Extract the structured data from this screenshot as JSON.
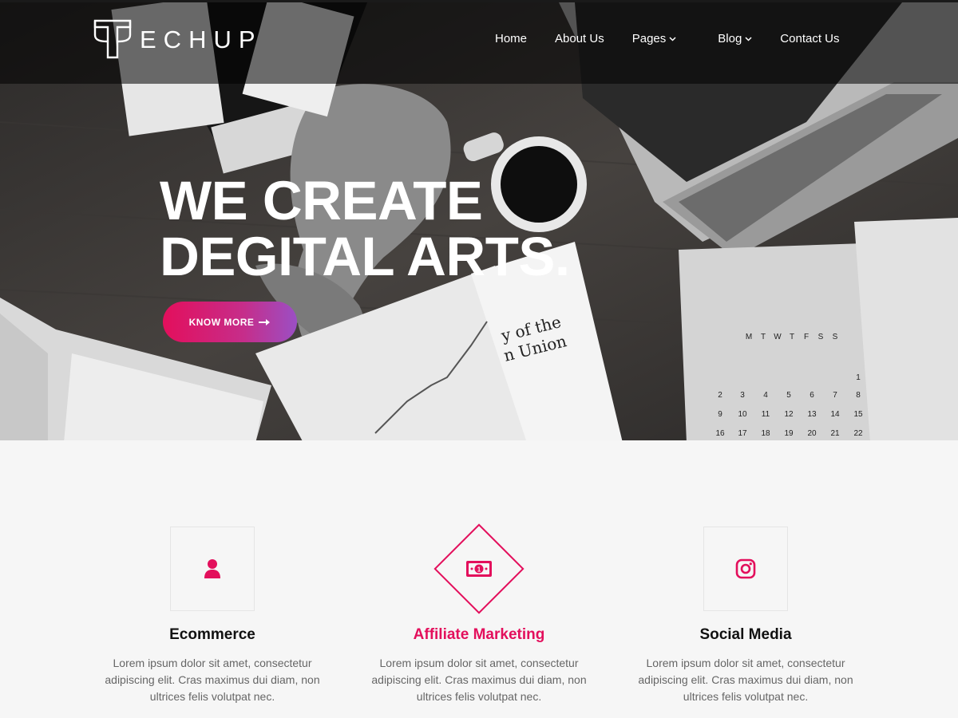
{
  "brand": {
    "logo_text": "ECHUP",
    "accent_color": "#e30f5c",
    "gradient_end": "#9b4fc4"
  },
  "nav": {
    "items": [
      {
        "label": "Home"
      },
      {
        "label": "About Us"
      },
      {
        "label": "Pages",
        "has_dropdown": true
      },
      {
        "label": "Blog",
        "has_dropdown": true
      },
      {
        "label": "Contact Us"
      }
    ]
  },
  "hero": {
    "headline_line1": "WE CREATE",
    "headline_line2": "DEGITAL ARTS.",
    "cta_label": "KNOW MORE",
    "background": "grayscale photo of business desk with laptop, coffee cup, newspaper chart and calendar",
    "calendar": {
      "weekdays": [
        "M",
        "T",
        "W",
        "T",
        "F",
        "S",
        "S"
      ],
      "rows": [
        [
          "",
          "",
          "",
          "",
          "",
          "",
          "1"
        ],
        [
          "2",
          "3",
          "4",
          "5",
          "6",
          "7",
          "8"
        ],
        [
          "9",
          "10",
          "11",
          "12",
          "13",
          "14",
          "15"
        ],
        [
          "16",
          "17",
          "18",
          "19",
          "20",
          "21",
          "22"
        ]
      ]
    }
  },
  "features": [
    {
      "icon": "user-icon",
      "title": "Ecommerce",
      "description": "Lorem ipsum dolor sit amet, consectetur adipiscing elit. Cras maximus dui diam, non ultrices felis volutpat nec."
    },
    {
      "icon": "money-bill-icon",
      "title": "Affiliate Marketing",
      "active": true,
      "description": "Lorem ipsum dolor sit amet, consectetur adipiscing elit. Cras maximus dui diam, non ultrices felis volutpat nec."
    },
    {
      "icon": "instagram-icon",
      "title": "Social Media",
      "description": "Lorem ipsum dolor sit amet, consectetur adipiscing elit. Cras maximus dui diam, non ultrices felis volutpat nec."
    }
  ]
}
